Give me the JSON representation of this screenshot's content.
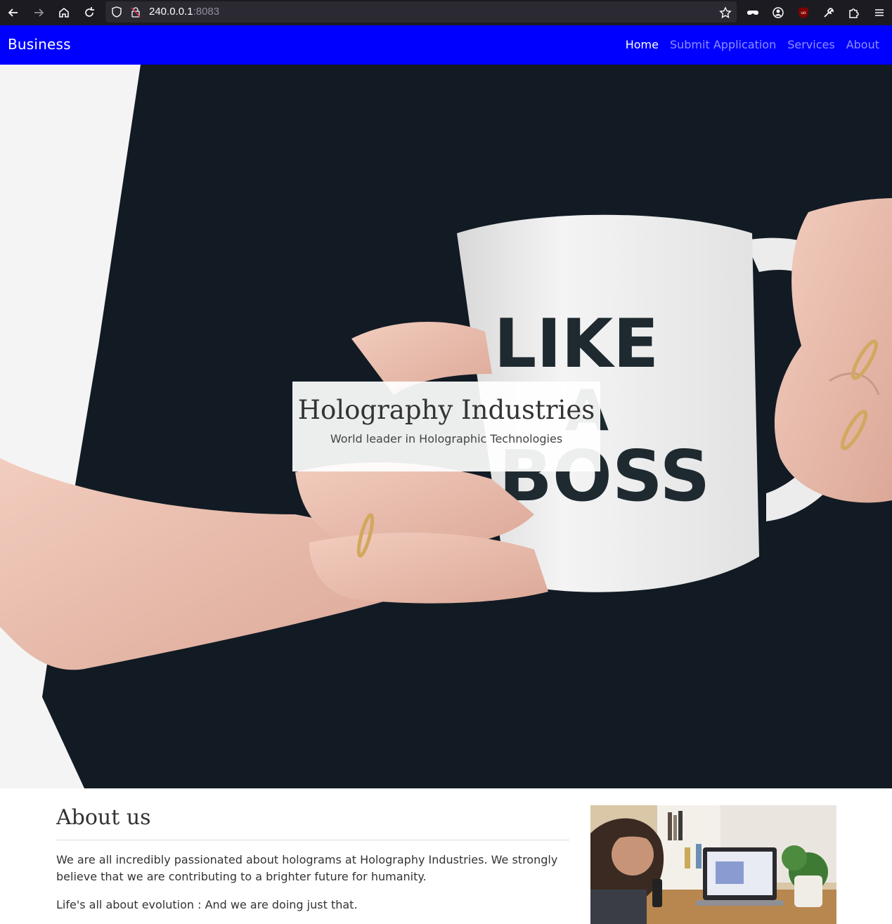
{
  "browser": {
    "url_host": "240.0.0.1",
    "url_port": ":8083"
  },
  "site": {
    "brand": "Business",
    "nav": [
      {
        "label": "Home",
        "active": true
      },
      {
        "label": "Submit Application",
        "active": false
      },
      {
        "label": "Services",
        "active": false
      },
      {
        "label": "About",
        "active": false
      }
    ]
  },
  "hero": {
    "title": "Holography Industries",
    "subtitle": "World leader in Holographic Technologies",
    "mug_text_1": "LIKE",
    "mug_text_2": "A",
    "mug_text_3": "BOSS"
  },
  "about": {
    "title": "About us",
    "p1": "We are all incredibly passionated about holograms at Holography Industries. We strongly believe that we are contributing to a brighter future for humanity.",
    "p2": "Life's all about evolution : And we are doing just that."
  },
  "colors": {
    "navbar": "#0000ff",
    "browser": "#1c1b22"
  }
}
